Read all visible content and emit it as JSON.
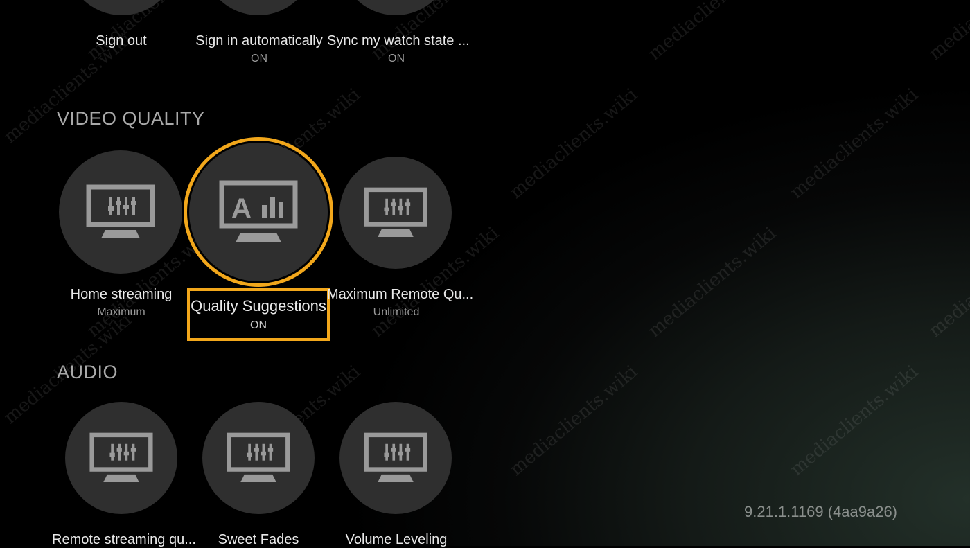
{
  "account": {
    "items": [
      {
        "label": "Sign out",
        "value": ""
      },
      {
        "label": "Sign in automatically",
        "value": "ON"
      },
      {
        "label": "Sync my watch state ...",
        "value": "ON"
      }
    ]
  },
  "video_quality": {
    "title": "VIDEO QUALITY",
    "items": [
      {
        "label": "Home streaming",
        "value": "Maximum"
      },
      {
        "label": "Quality Suggestions",
        "value": "ON"
      },
      {
        "label": "Maximum Remote Qu...",
        "value": "Unlimited"
      }
    ]
  },
  "audio": {
    "title": "AUDIO",
    "items": [
      {
        "label": "Remote streaming qu..."
      },
      {
        "label": "Sweet Fades"
      },
      {
        "label": "Volume Leveling"
      }
    ]
  },
  "version": "9.21.1.1169 (4aa9a26)",
  "watermark": "mediaclients.wiki",
  "colors": {
    "focus": "#f2a71b",
    "tile": "#2f2f2f",
    "icon": "#9a9a9a"
  }
}
